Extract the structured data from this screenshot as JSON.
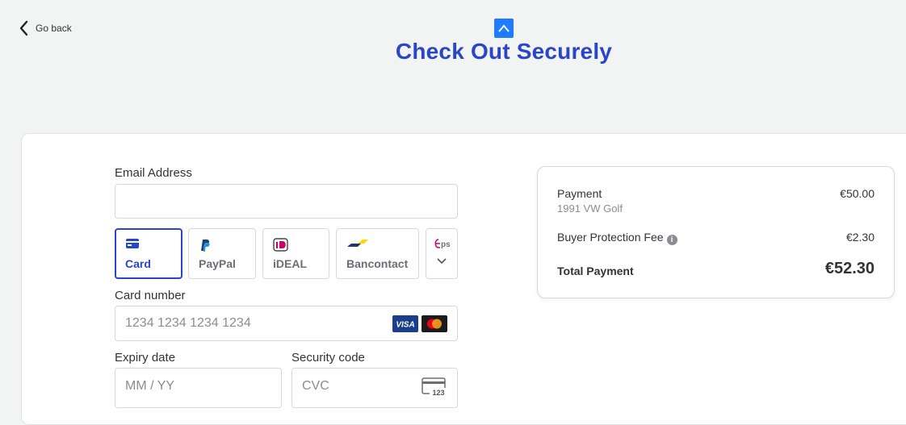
{
  "header": {
    "go_back_label": "Go back",
    "title": "Check Out Securely"
  },
  "form": {
    "email_label": "Email Address",
    "email_value": "",
    "payment_methods": [
      {
        "label": "Card",
        "active": true,
        "icon": "card-icon"
      },
      {
        "label": "PayPal",
        "active": false,
        "icon": "paypal-icon"
      },
      {
        "label": "iDEAL",
        "active": false,
        "icon": "ideal-icon"
      },
      {
        "label": "Bancontact",
        "active": false,
        "icon": "bancontact-icon"
      },
      {
        "label": "eps",
        "active": false,
        "icon": "eps-icon"
      }
    ],
    "card_number_label": "Card number",
    "card_number_placeholder": "1234 1234 1234 1234",
    "card_brands": [
      "VISA",
      "Mastercard"
    ],
    "expiry_label": "Expiry date",
    "expiry_placeholder": "MM / YY",
    "security_label": "Security code",
    "security_placeholder": "CVC",
    "cvc_icon_text": "123"
  },
  "summary": {
    "payment_label": "Payment",
    "payment_item": "1991 VW Golf",
    "payment_amount": "€50.00",
    "fee_label": "Buyer Protection Fee",
    "fee_amount": "€2.30",
    "total_label": "Total Payment",
    "total_amount": "€52.30"
  },
  "colors": {
    "accent": "#2a46c8",
    "logo": "#1f7bff",
    "background": "#f2f3f3"
  }
}
